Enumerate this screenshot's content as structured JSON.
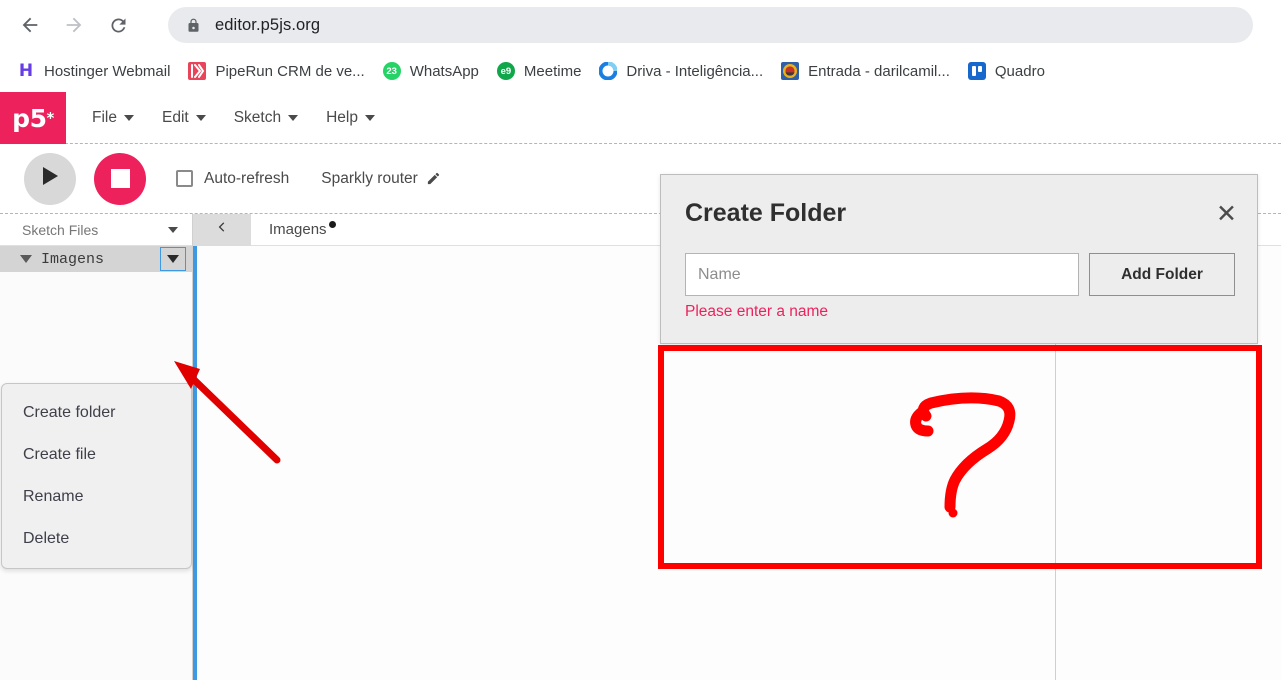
{
  "browser": {
    "back_icon": "back-arrow-icon",
    "forward_icon": "forward-arrow-icon",
    "reload_icon": "reload-icon",
    "lock_icon": "lock-icon",
    "url": "editor.p5js.org",
    "bookmarks": [
      {
        "label": "Hostinger Webmail",
        "icon": "hostinger-icon",
        "icon_text": "H"
      },
      {
        "label": "PipeRun CRM de ve...",
        "icon": "piperun-icon",
        "icon_text": "))"
      },
      {
        "label": "WhatsApp",
        "icon": "whatsapp-icon",
        "icon_text": "23"
      },
      {
        "label": "Meetime",
        "icon": "meetime-icon",
        "icon_text": "e9"
      },
      {
        "label": "Driva - Inteligência...",
        "icon": "driva-icon",
        "icon_text": ""
      },
      {
        "label": "Entrada - darilcamil...",
        "icon": "entrada-icon",
        "icon_text": ""
      },
      {
        "label": "Quadro",
        "icon": "trello-icon",
        "icon_text": ""
      }
    ]
  },
  "p5": {
    "logo": "p5",
    "logo_star": "*",
    "menu": [
      {
        "label": "File"
      },
      {
        "label": "Edit"
      },
      {
        "label": "Sketch"
      },
      {
        "label": "Help"
      }
    ],
    "toolbar": {
      "play_icon": "play-icon",
      "stop_icon": "stop-icon",
      "auto_refresh_label": "Auto-refresh",
      "auto_refresh_checked": false,
      "sketch_name": "Sparkly router",
      "edit_icon": "pencil-icon"
    },
    "sidebar": {
      "title": "Sketch Files",
      "collapse_icon": "chevron-down-icon",
      "tree": [
        {
          "label": "Imagens",
          "expanded": true,
          "actions_icon": "chevron-down-icon"
        }
      ]
    },
    "context_menu": {
      "items": [
        {
          "label": "Create folder"
        },
        {
          "label": "Create file"
        },
        {
          "label": "Rename"
        },
        {
          "label": "Delete"
        }
      ]
    },
    "tabs": {
      "collapse_icon": "chevron-left-icon",
      "active": {
        "label": "Imagens",
        "modified": true
      }
    }
  },
  "modal": {
    "title": "Create Folder",
    "close_icon": "close-icon",
    "name_value": "",
    "name_placeholder": "Name",
    "submit_label": "Add Folder",
    "error": "Please enter a name"
  },
  "annotations": {
    "box_color": "#fe0000",
    "arrow_color": "#e00000",
    "question_mark": "?"
  },
  "colors": {
    "p5_pink": "#ed225d",
    "accent_blue": "#3d9ae2",
    "annotation_red": "#fe0000"
  }
}
